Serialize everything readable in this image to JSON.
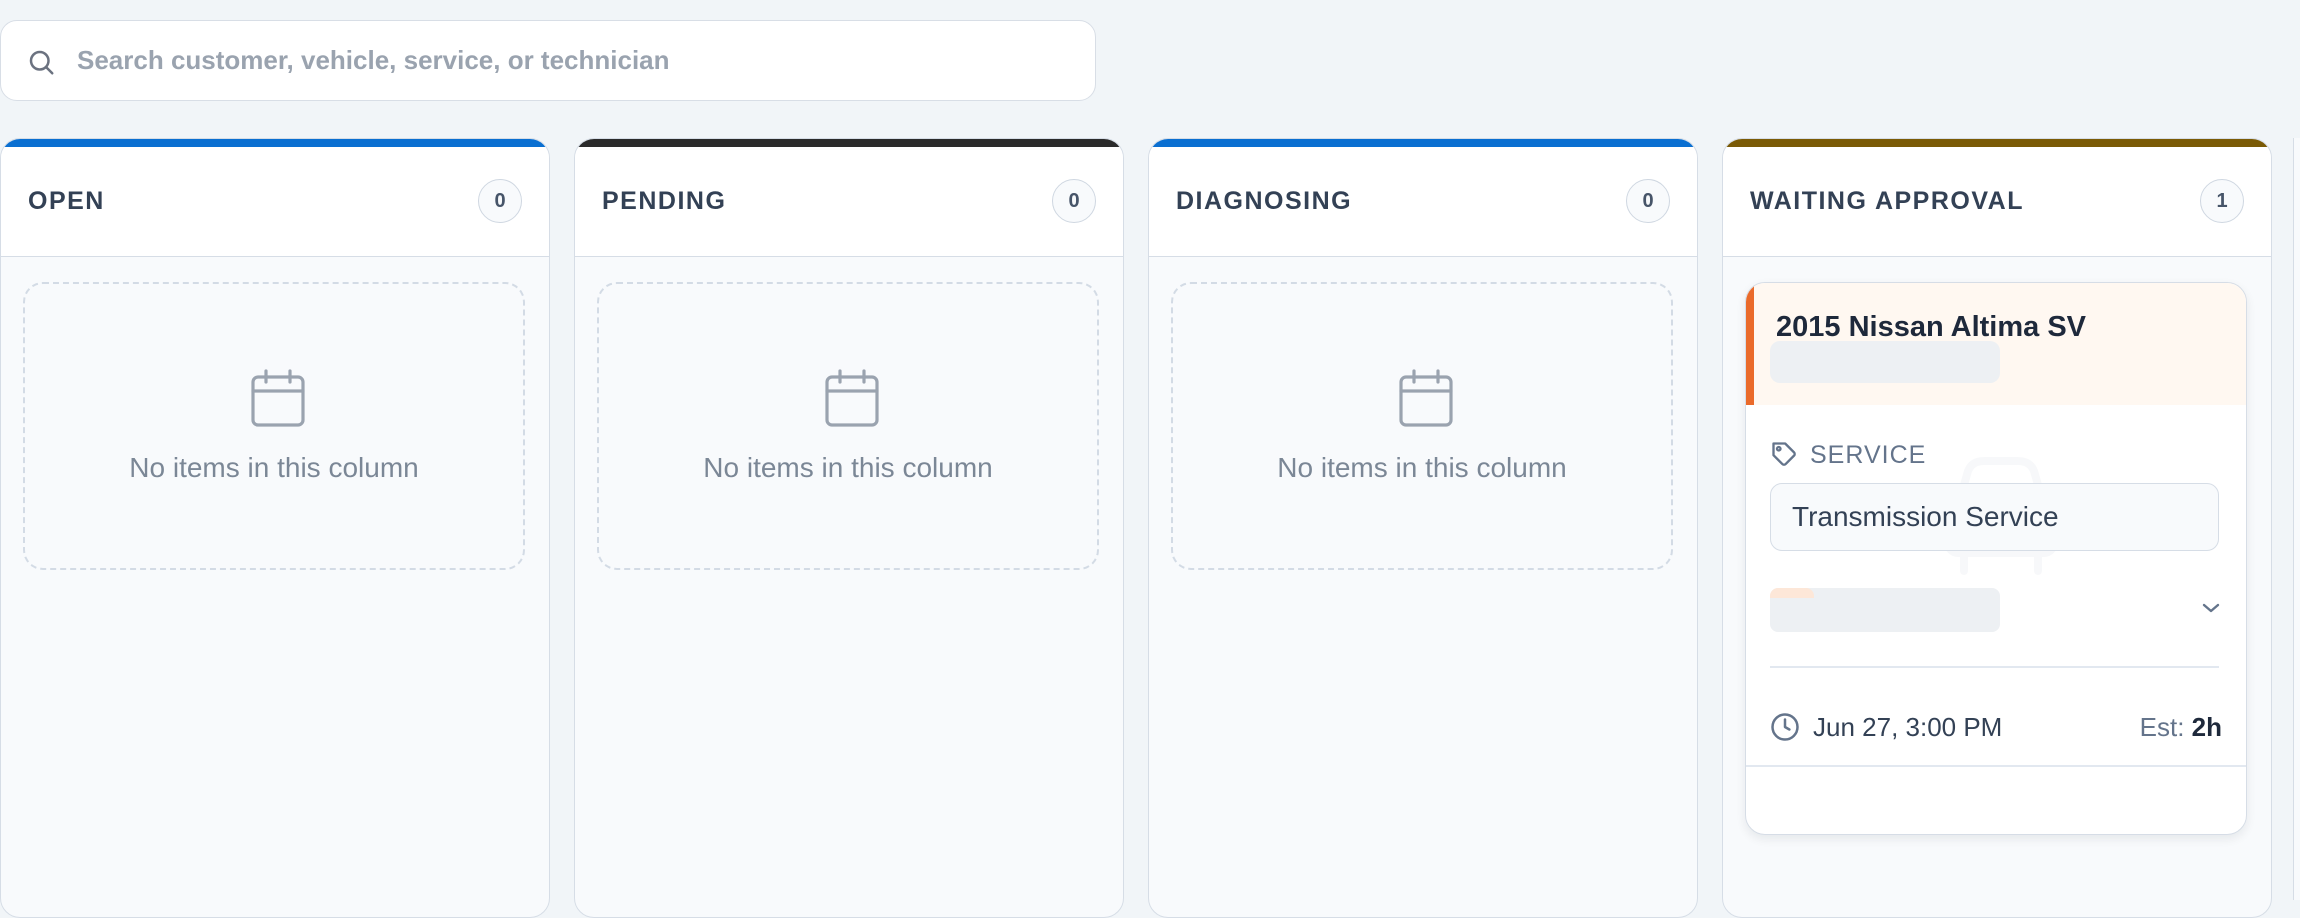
{
  "search": {
    "placeholder": "Search customer, vehicle, service, or technician",
    "icon": "search-icon"
  },
  "colors": {
    "open": "#0a6fd1",
    "pending": "#2b2b2b",
    "diagnosing": "#0a6fd1",
    "waiting_approval": "#7a5a06",
    "card_accent": "#ea6a2a"
  },
  "columns": [
    {
      "title": "OPEN",
      "count": "0",
      "empty_text": "No items in this column",
      "icon": "calendar-icon"
    },
    {
      "title": "PENDING",
      "count": "0",
      "empty_text": "No items in this column",
      "icon": "calendar-icon"
    },
    {
      "title": "DIAGNOSING",
      "count": "0",
      "empty_text": "No items in this column",
      "icon": "calendar-icon"
    },
    {
      "title": "WAITING APPROVAL",
      "count": "1",
      "cards": [
        {
          "vehicle": "2015 Nissan Altima SV",
          "service_label": "SERVICE",
          "service": "Transmission Service",
          "time": "Jun 27, 3:00 PM",
          "est_label": "Est:",
          "est_value": "2h",
          "icons": [
            "tag-icon",
            "chevron-down-icon",
            "clock-icon"
          ]
        }
      ]
    }
  ]
}
